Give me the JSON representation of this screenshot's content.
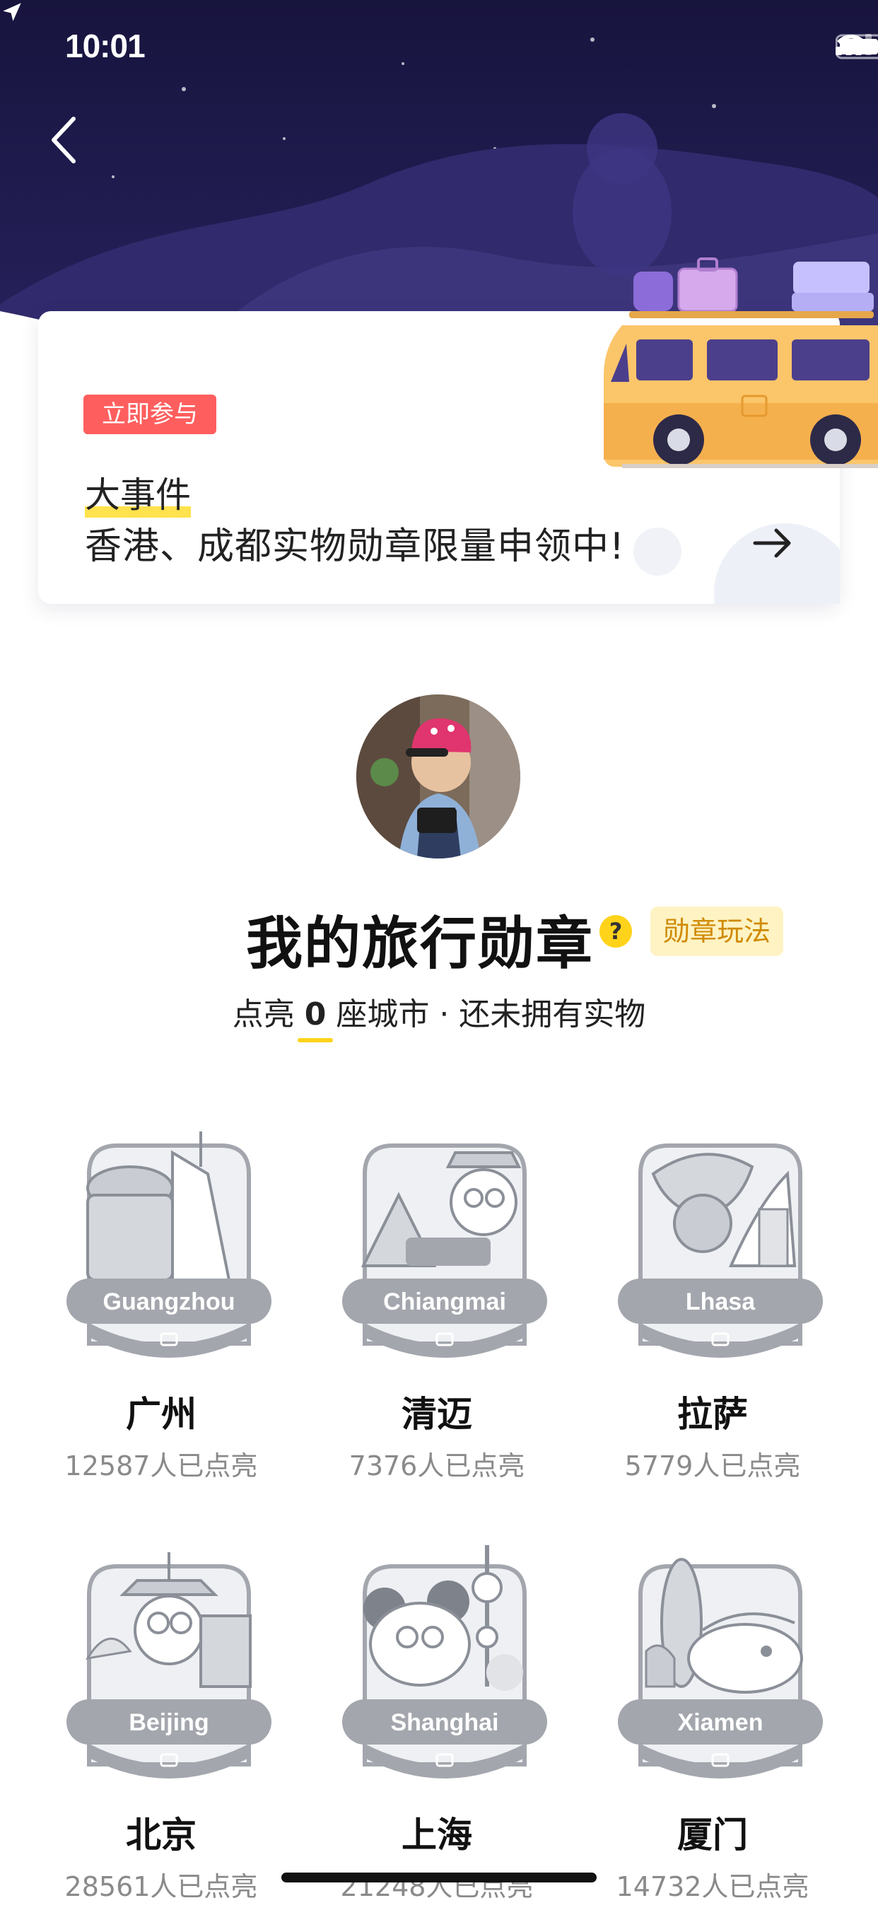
{
  "status_bar": {
    "time": "10:01"
  },
  "event": {
    "tag": "立即参与",
    "title": "大事件",
    "description": "香港、成都实物勋章限量申领中!"
  },
  "profile": {
    "title": "我的旅行勋章",
    "help": "?",
    "rules_label": "勋章玩法",
    "summary_prefix": "点亮",
    "summary_count": "0",
    "summary_suffix": "座城市 · 还未拥有实物"
  },
  "badges": [
    {
      "label_en": "Guangzhou",
      "name": "广州",
      "count": "12587人已点亮"
    },
    {
      "label_en": "Chiangmai",
      "name": "清迈",
      "count": "7376人已点亮"
    },
    {
      "label_en": "Lhasa",
      "name": "拉萨",
      "count": "5779人已点亮"
    },
    {
      "label_en": "Beijing",
      "name": "北京",
      "count": "28561人已点亮"
    },
    {
      "label_en": "Shanghai",
      "name": "上海",
      "count": "21248人已点亮"
    },
    {
      "label_en": "Xiamen",
      "name": "厦门",
      "count": "14732人已点亮"
    }
  ],
  "colors": {
    "hero_dark": "#1e1a4a",
    "hero_mid": "#3b3478",
    "tag_red": "#ff5e5e",
    "accent_yellow": "#ffd31a",
    "badge_gray": "#a3a6ad"
  }
}
